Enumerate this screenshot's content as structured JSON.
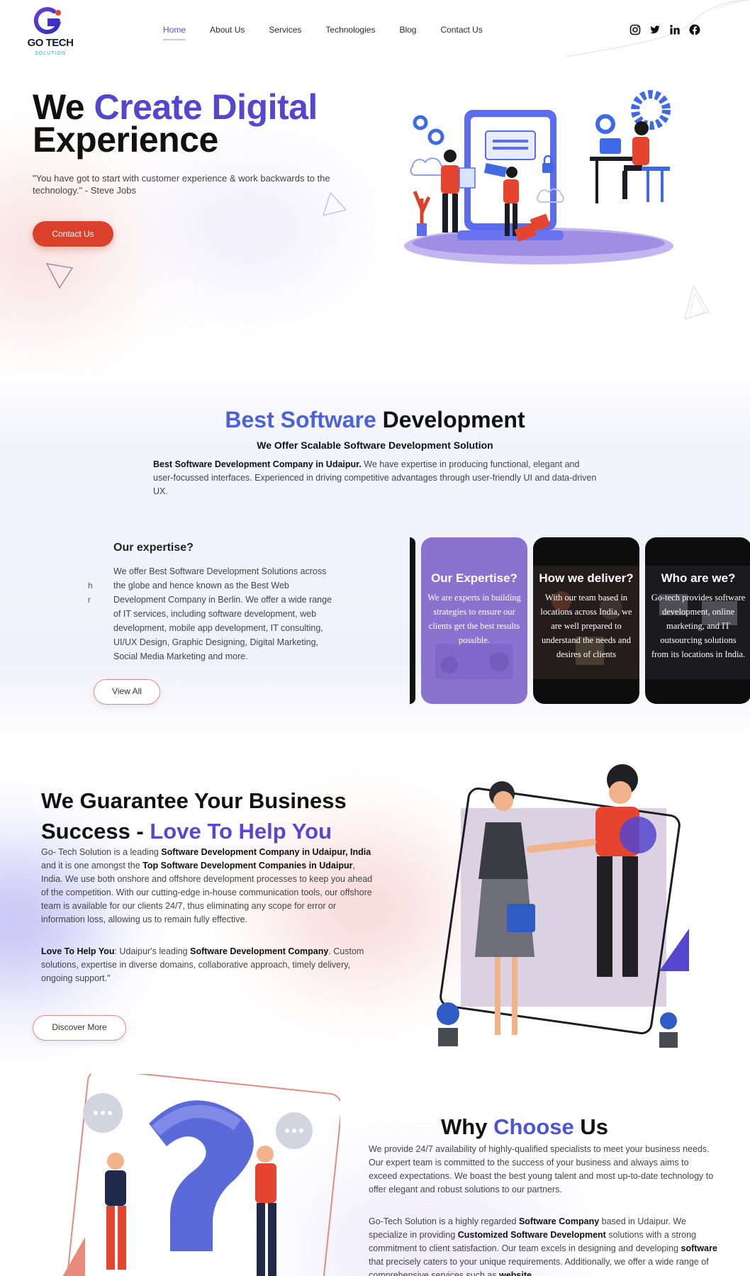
{
  "brand": {
    "name": "GO TECH",
    "tagline": "SOLUTION",
    "colors": {
      "primary": "#5446cf",
      "accent_red": "#d9412d",
      "blue": "#4a63d8"
    }
  },
  "nav": {
    "items": [
      {
        "label": "Home",
        "active": true
      },
      {
        "label": "About Us",
        "active": false
      },
      {
        "label": "Services",
        "active": false
      },
      {
        "label": "Technologies",
        "active": false
      },
      {
        "label": "Blog",
        "active": false
      },
      {
        "label": "Contact Us",
        "active": false
      }
    ],
    "social_icons": [
      "instagram-icon",
      "twitter-icon",
      "linkedin-icon",
      "facebook-icon"
    ],
    "social_glyphs": [
      "◎",
      "✦",
      "in",
      "f"
    ]
  },
  "hero": {
    "title_part1": "We ",
    "title_accent": "Create Digital",
    "title_line2": "Experience",
    "quote": "\"You have got to start with customer experience & work backwards to the technology.\" - Steve Jobs",
    "cta_label": "Contact Us"
  },
  "software": {
    "title_accent": "Best Software",
    "title_rest": " Development",
    "subtitle": "We Offer Scalable Software Development Solution",
    "lead_bold": "Best Software Development Company in Udaipur.",
    "lead_text": " We have expertise in producing functional, elegant and user-focussed interfaces. Experienced in driving competitive advantages through user-friendly UI and data-driven UX."
  },
  "expertise": {
    "title": "Our expertise?",
    "text": "We offer Best Software Development Solutions across the globe and hence known as the Best Web Development Company in Berlin. We offer a wide range of IT services, including software development, web development, mobile app development, IT consulting, UI/UX Design, Graphic Designing, Digital Marketing, Social Media Marketing and more.",
    "ghost_chars": "h\nr",
    "button_label": "View All",
    "cards": [
      {
        "title": "Our Expertise?",
        "body": "We are experts in building strategies to ensure our clients get the best results possible."
      },
      {
        "title": "How we deliver?",
        "body": "With our team based in locations across India, we are well prepared to understand the needs and desires of clients"
      },
      {
        "title": "Who are we?",
        "body": "Go-tech provides software development, online marketing, and IT outsourcing solutions from its locations in India."
      }
    ]
  },
  "guarantee": {
    "title_line1": "We Guarantee Your Business",
    "title_line2_part1": "Success - ",
    "title_accent": "Love To Help You",
    "p1_a": "Go- Tech Solution is a leading ",
    "p1_b": "Software Development Company in Udaipur, India",
    "p1_c": " and it is one amongst the ",
    "p1_d": "Top Software Development Companies in Udaipur",
    "p1_e": ", India. We use both onshore and offshore development processes to keep you ahead of the competition. With our cutting-edge in-house communication tools, our offshore team is available for our clients 24/7, thus eliminating any scope for error or information loss, allowing us to remain fully effective.",
    "p2_a": "Love To Help You",
    "p2_b": ": Udaipur's leading ",
    "p2_c": "Software Development Company",
    "p2_d": ". Custom solutions, expertise in diverse domains, collaborative approach, timely delivery, ongoing support.\"",
    "button_label": "Discover More"
  },
  "why": {
    "title_part1": "Why ",
    "title_accent": "Choose",
    "title_part2": " Us",
    "p1": "We provide 24/7 availability of highly-qualified specialists to meet your business needs. Our expert team is committed to the success of your business and always aims to exceed expectations. We boast the best young talent and most up-to-date technology to offer elegant and robust solutions to our partners.",
    "p2_a": "Go-Tech Solution is a highly regarded ",
    "p2_b": "Software Company",
    "p2_c": " based in Udaipur. We specialize in providing ",
    "p2_d": "Customized Software Development",
    "p2_e": " solutions with a strong commitment to client satisfaction. Our team excels in designing and developing ",
    "p2_f": "software",
    "p2_g": " that precisely caters to your unique requirements. Additionally, we offer a wide range of comprehensive services such as ",
    "p2_h": "website"
  }
}
